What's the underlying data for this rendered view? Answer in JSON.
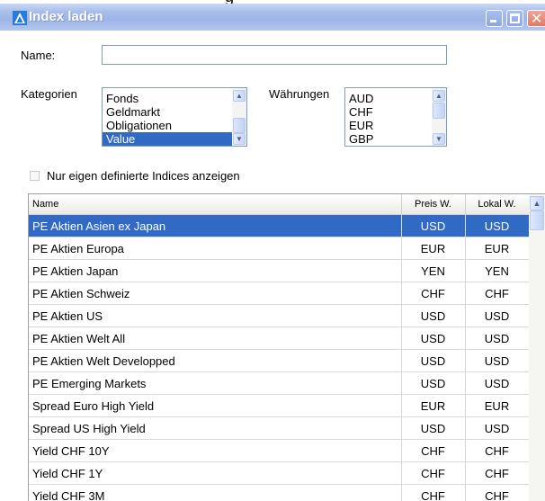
{
  "window": {
    "title": "Index laden",
    "top_strip_text": "g",
    "colors": {
      "titlebar": "#9db4e6",
      "selection": "#316ac5"
    }
  },
  "form": {
    "name_label": "Name:",
    "name_value": "",
    "kategorien_label": "Kategorien",
    "kategorien_items": [
      "Fonds",
      "Geldmarkt",
      "Obligationen",
      "Value"
    ],
    "kategorien_selected": "Value",
    "waehrungen_label": "Währungen",
    "waehrungen_items": [
      "AUD",
      "CHF",
      "EUR",
      "GBP"
    ],
    "checkbox_label": "Nur eigen definierte Indices anzeigen",
    "checkbox_checked": false
  },
  "table": {
    "columns": [
      "Name",
      "Preis W.",
      "Lokal W."
    ],
    "rows": [
      {
        "name": "PE Aktien Asien ex Japan",
        "preis": "USD",
        "lokal": "USD",
        "selected": true
      },
      {
        "name": "PE Aktien Europa",
        "preis": "EUR",
        "lokal": "EUR"
      },
      {
        "name": "PE Aktien Japan",
        "preis": "YEN",
        "lokal": "YEN"
      },
      {
        "name": "PE Aktien Schweiz",
        "preis": "CHF",
        "lokal": "CHF"
      },
      {
        "name": "PE Aktien US",
        "preis": "USD",
        "lokal": "USD"
      },
      {
        "name": "PE Aktien Welt All",
        "preis": "USD",
        "lokal": "USD"
      },
      {
        "name": "PE Aktien Welt Developped",
        "preis": "USD",
        "lokal": "USD"
      },
      {
        "name": "PE Emerging Markets",
        "preis": "USD",
        "lokal": "USD"
      },
      {
        "name": "Spread Euro High Yield",
        "preis": "EUR",
        "lokal": "EUR"
      },
      {
        "name": "Spread US High Yield",
        "preis": "USD",
        "lokal": "USD"
      },
      {
        "name": "Yield CHF 10Y",
        "preis": "CHF",
        "lokal": "CHF"
      },
      {
        "name": "Yield CHF 1Y",
        "preis": "CHF",
        "lokal": "CHF"
      },
      {
        "name": "Yield CHF 3M",
        "preis": "CHF",
        "lokal": "CHF"
      }
    ]
  },
  "icons": {
    "app": "index-app-icon",
    "minimize": "minimize-icon",
    "maximize": "maximize-icon",
    "close": "close-icon"
  }
}
